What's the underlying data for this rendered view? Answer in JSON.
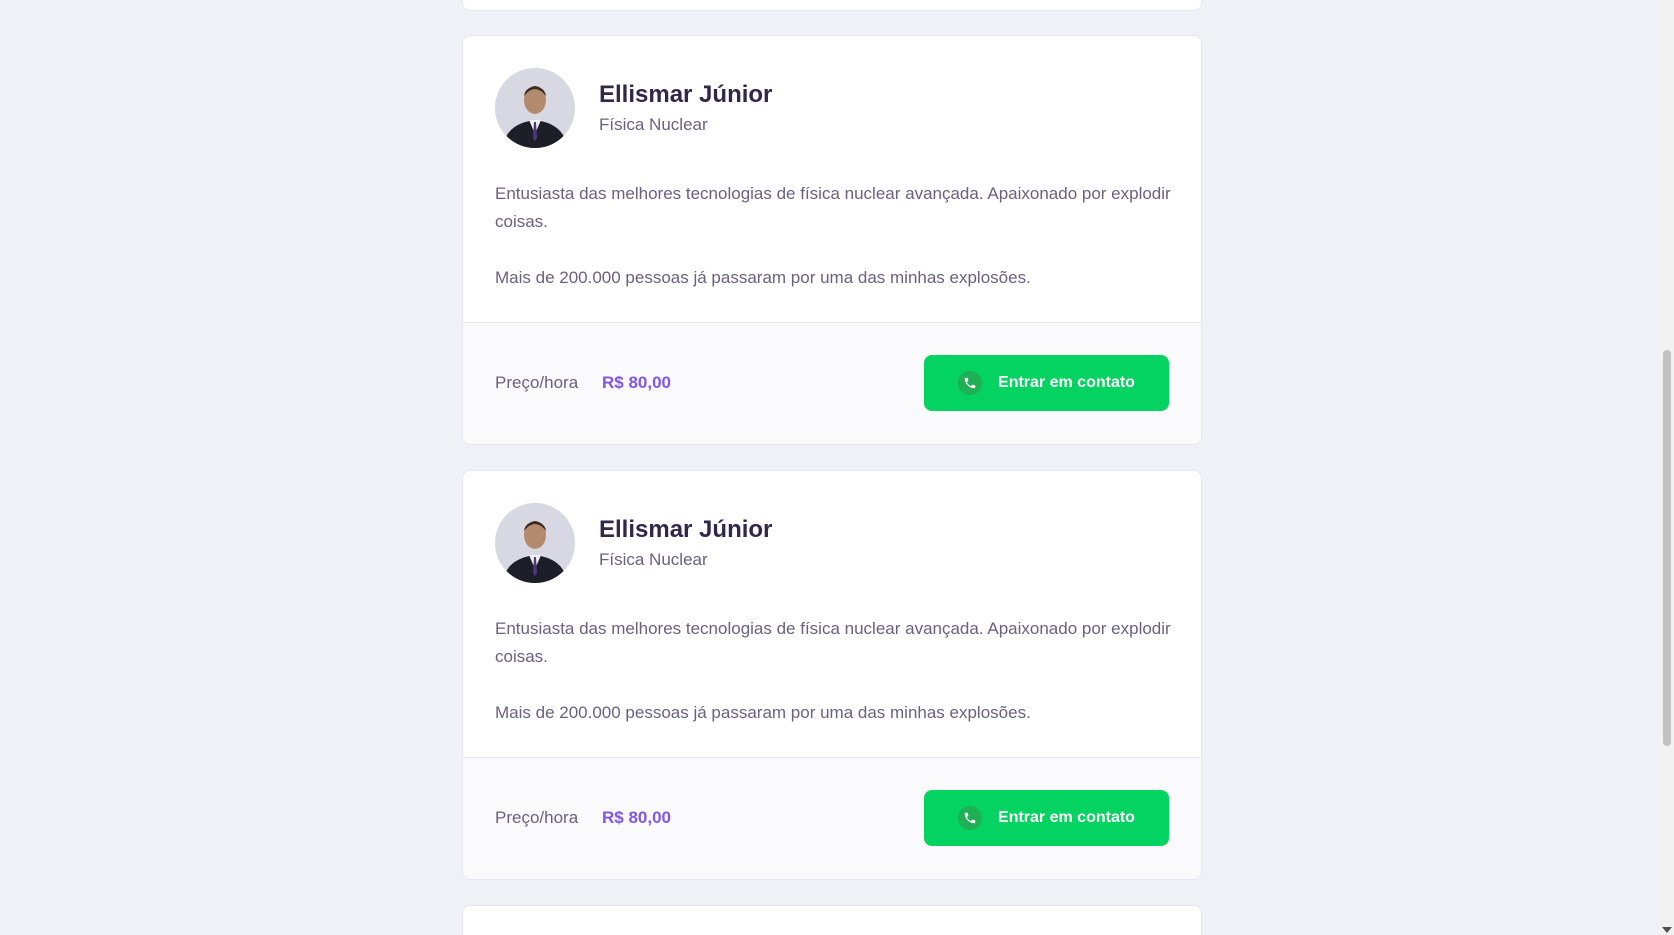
{
  "teachers": [
    {
      "name": "Ellismar Júnior",
      "subject": "Física Nuclear",
      "bio_paragraph_1": "Entusiasta das melhores tecnologias de física nuclear avançada. Apaixonado por explodir coisas.",
      "bio_paragraph_2": "Mais de 200.000 pessoas já passaram por uma das minhas explosões.",
      "price_label": "Preço/hora",
      "price_value": "R$ 80,00",
      "contact_label": "Entrar em contato"
    },
    {
      "name": "Ellismar Júnior",
      "subject": "Física Nuclear",
      "bio_paragraph_1": "Entusiasta das melhores tecnologias de física nuclear avançada. Apaixonado por explodir coisas.",
      "bio_paragraph_2": "Mais de 200.000 pessoas já passaram por uma das minhas explosões.",
      "price_label": "Preço/hora",
      "price_value": "R$ 80,00",
      "contact_label": "Entrar em contato"
    }
  ],
  "colors": {
    "background": "#F0F0F7",
    "title": "#32264D",
    "text": "#6A6180",
    "price": "#8257E5",
    "contact_button": "#04D361"
  },
  "icons": {
    "contact_button_icon": "whatsapp-icon",
    "scroll_down": "chevron-down-icon"
  }
}
